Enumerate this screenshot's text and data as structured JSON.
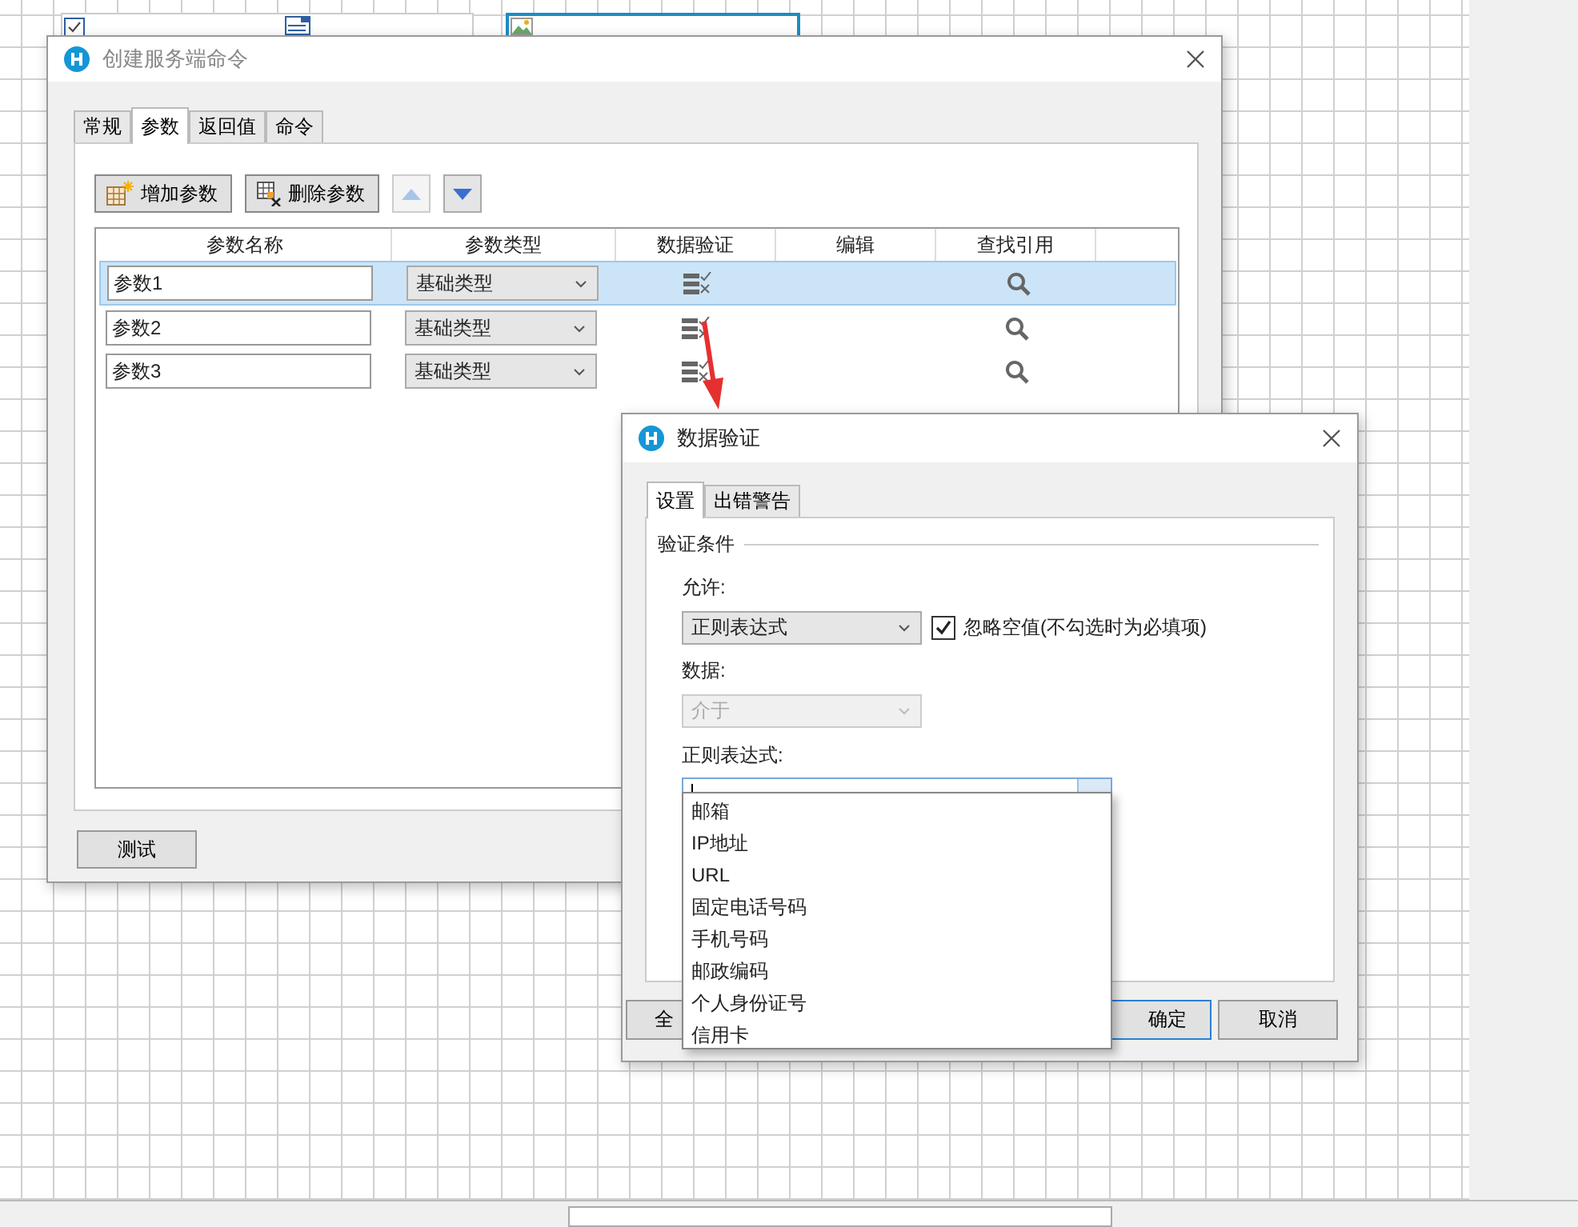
{
  "command_dialog": {
    "title": "创建服务端命令",
    "tabs": [
      {
        "label": "常规",
        "selected": false
      },
      {
        "label": "参数",
        "selected": true
      },
      {
        "label": "返回值",
        "selected": false
      },
      {
        "label": "命令",
        "selected": false
      }
    ],
    "toolbar": {
      "add_button": "增加参数",
      "delete_button": "删除参数",
      "move_up": {
        "disabled": true
      },
      "move_down": {
        "disabled": false
      }
    },
    "table": {
      "columns": [
        "参数名称",
        "参数类型",
        "数据验证",
        "编辑",
        "查找引用"
      ],
      "rows": [
        {
          "name": "参数1",
          "type": "基础类型",
          "selected": true
        },
        {
          "name": "参数2",
          "type": "基础类型",
          "selected": false
        },
        {
          "name": "参数3",
          "type": "基础类型",
          "selected": false
        }
      ]
    },
    "test_button": "测试"
  },
  "validation_dialog": {
    "title": "数据验证",
    "tabs": [
      {
        "label": "设置",
        "selected": true
      },
      {
        "label": "出错警告",
        "selected": false
      }
    ],
    "section_title": "验证条件",
    "allow": {
      "label": "允许:",
      "value": "正则表达式"
    },
    "ignore_blank": {
      "label": "忽略空值(不勾选时为必填项)",
      "checked": true
    },
    "data": {
      "label": "数据:",
      "value": "介于",
      "disabled": true
    },
    "regex": {
      "label": "正则表达式:",
      "expanded": true,
      "options": [
        "邮箱",
        "IP地址",
        "URL",
        "固定电话号码",
        "手机号码",
        "邮政编码",
        "个人身份证号",
        "信用卡"
      ]
    },
    "buttons": [
      {
        "label": "全",
        "default": false
      },
      {
        "label": "确定",
        "default": true
      },
      {
        "label": "取消",
        "default": false
      }
    ]
  }
}
